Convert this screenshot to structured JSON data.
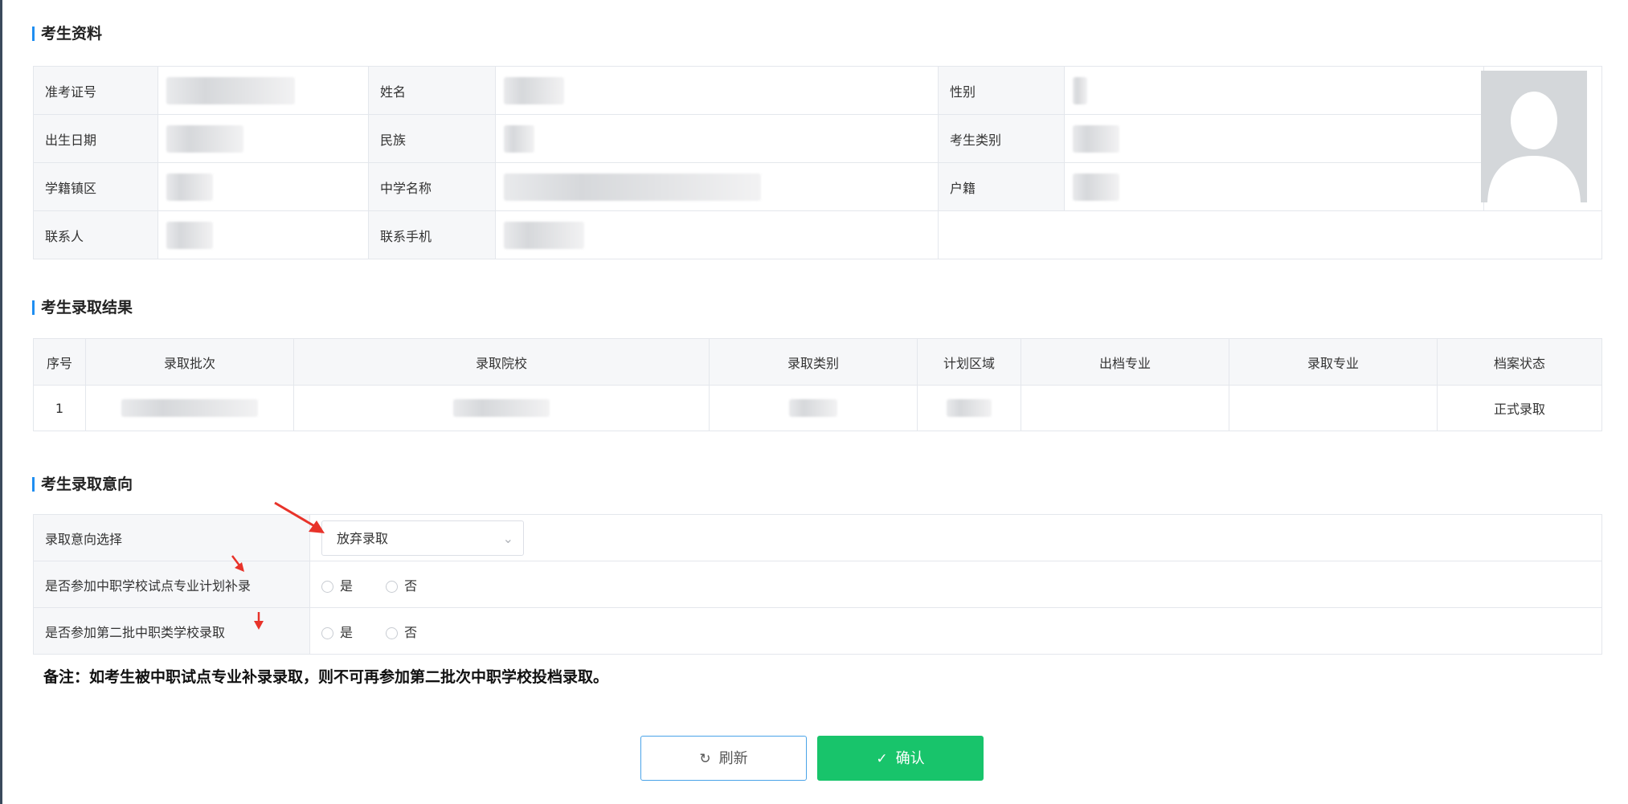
{
  "sections": {
    "info_title": "考生资料",
    "result_title": "考生录取结果",
    "intent_title": "考生录取意向"
  },
  "info": {
    "admission_no_label": "准考证号",
    "name_label": "姓名",
    "gender_label": "性别",
    "birth_label": "出生日期",
    "ethnicity_label": "民族",
    "category_label": "考生类别",
    "district_label": "学籍镇区",
    "school_label": "中学名称",
    "household_label": "户籍",
    "contact_label": "联系人",
    "phone_label": "联系手机"
  },
  "result": {
    "headers": [
      "序号",
      "录取批次",
      "录取院校",
      "录取类别",
      "计划区域",
      "出档专业",
      "录取专业",
      "档案状态"
    ],
    "row": {
      "index": "1",
      "status": "正式录取"
    }
  },
  "intent": {
    "choice_label": "录取意向选择",
    "choice_value": "放弃录取",
    "supplement_label": "是否参加中职学校试点专业计划补录",
    "second_batch_label": "是否参加第二批中职类学校录取",
    "yes": "是",
    "no": "否"
  },
  "note": "备注：如考生被中职试点专业补录录取，则不可再参加第二批次中职学校投档录取。",
  "buttons": {
    "refresh": "刷新",
    "confirm": "确认"
  },
  "icons": {
    "refresh": "refresh-icon",
    "confirm": "edit-check-icon",
    "avatar": "user-silhouette-icon",
    "dropdown": "chevron-down-icon"
  },
  "colors": {
    "accent": "#1f8ef1",
    "confirm": "#18c46b",
    "annotation": "#e8332a"
  }
}
